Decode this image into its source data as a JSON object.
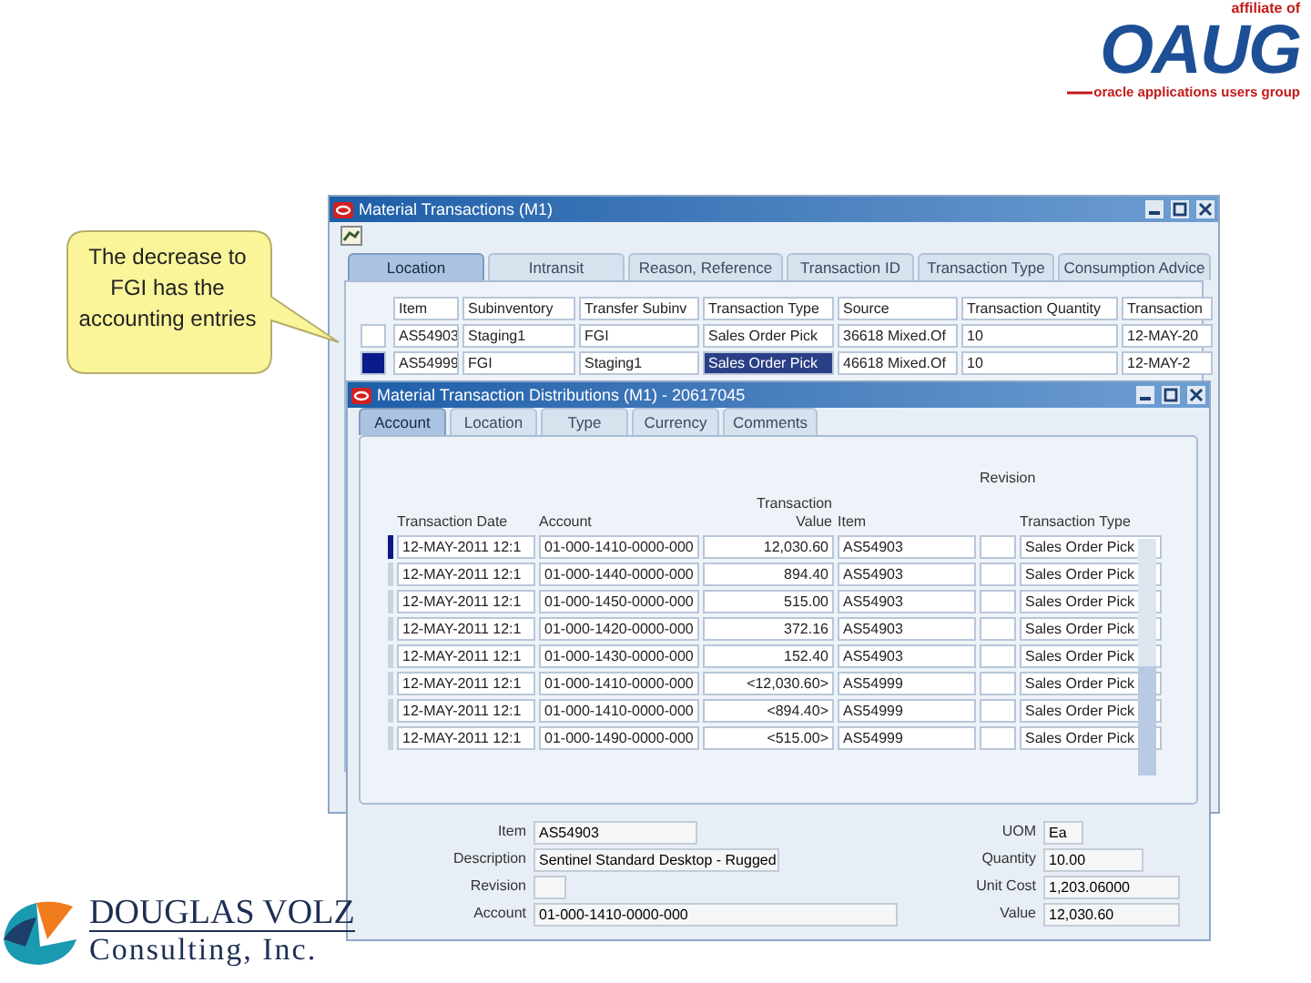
{
  "callout": {
    "text": "The decrease to FGI has the accounting entries"
  },
  "top_logo": {
    "caption": "affiliate of",
    "letters": "OAUG",
    "tagline": "oracle applications users group"
  },
  "bottom_logo": {
    "name": "DOUGLAS VOLZ",
    "subtitle": "Consulting, Inc."
  },
  "back_window": {
    "title": "Material Transactions (M1)",
    "tabs": [
      {
        "label": "Location",
        "selected": true
      },
      {
        "label": "Intransit",
        "selected": false
      },
      {
        "label": "Reason, Reference",
        "selected": false
      },
      {
        "label": "Transaction ID",
        "selected": false
      },
      {
        "label": "Transaction Type",
        "selected": false
      },
      {
        "label": "Consumption Advice",
        "selected": false
      }
    ],
    "columns": [
      "Item",
      "Subinventory",
      "Transfer Subinv",
      "Transaction Type",
      "Source",
      "Transaction Quantity",
      "Transaction"
    ],
    "rows": [
      {
        "selected": false,
        "cells": [
          "AS54903",
          "Staging1",
          "FGI",
          "Sales Order Pick",
          "36618 Mixed.Of",
          "10",
          "12-MAY-20"
        ]
      },
      {
        "selected": true,
        "cells": [
          "AS54999",
          "FGI",
          "Staging1",
          "Sales Order Pick",
          "46618 Mixed.Of",
          "10",
          "12-MAY-2"
        ]
      }
    ]
  },
  "front_window": {
    "title": "Material Transaction Distributions (M1) - 20617045",
    "tabs": [
      {
        "label": "Account",
        "selected": true
      },
      {
        "label": "Location",
        "selected": false
      },
      {
        "label": "Type",
        "selected": false
      },
      {
        "label": "Currency",
        "selected": false
      },
      {
        "label": "Comments",
        "selected": false
      }
    ],
    "columns": [
      "Transaction Date",
      "Account",
      "Transaction Value",
      "Item",
      "Revision",
      "Transaction Type"
    ],
    "rows": [
      {
        "selected": true,
        "cells": [
          "12-MAY-2011 12:1",
          "01-000-1410-0000-000",
          "12,030.60",
          "AS54903",
          "",
          "Sales Order Pick"
        ]
      },
      {
        "selected": false,
        "cells": [
          "12-MAY-2011 12:1",
          "01-000-1440-0000-000",
          "894.40",
          "AS54903",
          "",
          "Sales Order Pick"
        ]
      },
      {
        "selected": false,
        "cells": [
          "12-MAY-2011 12:1",
          "01-000-1450-0000-000",
          "515.00",
          "AS54903",
          "",
          "Sales Order Pick"
        ]
      },
      {
        "selected": false,
        "cells": [
          "12-MAY-2011 12:1",
          "01-000-1420-0000-000",
          "372.16",
          "AS54903",
          "",
          "Sales Order Pick"
        ]
      },
      {
        "selected": false,
        "cells": [
          "12-MAY-2011 12:1",
          "01-000-1430-0000-000",
          "152.40",
          "AS54903",
          "",
          "Sales Order Pick"
        ]
      },
      {
        "selected": false,
        "cells": [
          "12-MAY-2011 12:1",
          "01-000-1410-0000-000",
          "<12,030.60>",
          "AS54999",
          "",
          "Sales Order Pick"
        ]
      },
      {
        "selected": false,
        "cells": [
          "12-MAY-2011 12:1",
          "01-000-1410-0000-000",
          "<894.40>",
          "AS54999",
          "",
          "Sales Order Pick"
        ]
      },
      {
        "selected": false,
        "cells": [
          "12-MAY-2011 12:1",
          "01-000-1490-0000-000",
          "<515.00>",
          "AS54999",
          "",
          "Sales Order Pick"
        ]
      }
    ],
    "left_fields": [
      {
        "label": "Item",
        "value": "AS54903"
      },
      {
        "label": "Description",
        "value": "Sentinel Standard Desktop - Rugged"
      },
      {
        "label": "Revision"
      },
      {
        "label": "Account",
        "value": "01-000-1410-0000-000"
      }
    ],
    "right_fields": [
      {
        "label": "UOM",
        "value": "Ea"
      },
      {
        "label": "Quantity",
        "value": "10.00"
      },
      {
        "label": "Unit Cost",
        "value": "1,203.06000"
      },
      {
        "label": "Value",
        "value": "12,030.60"
      }
    ]
  }
}
